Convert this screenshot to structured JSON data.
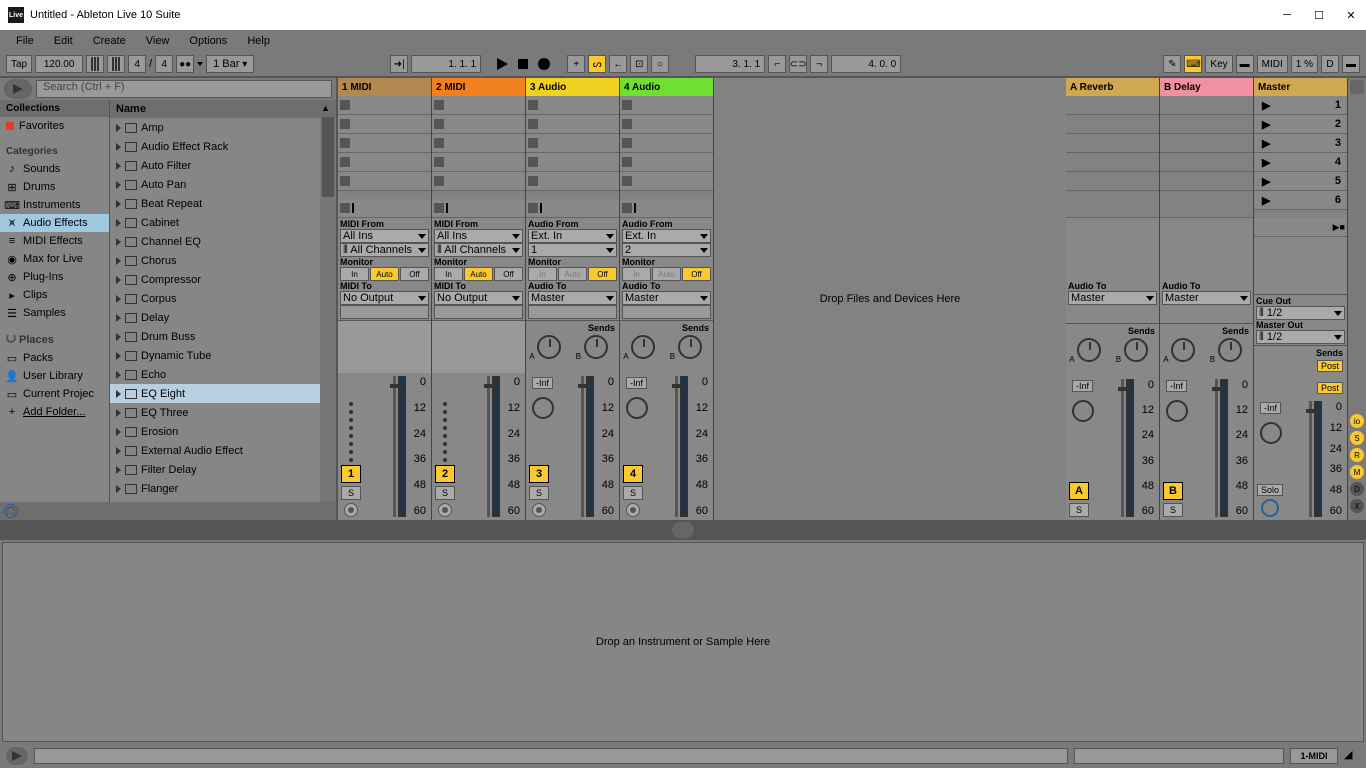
{
  "window": {
    "title": "Untitled - Ableton Live 10 Suite",
    "logo": "Live"
  },
  "menu": [
    "File",
    "Edit",
    "Create",
    "View",
    "Options",
    "Help"
  ],
  "ctrl": {
    "tap": "Tap",
    "bpm": "120.00",
    "sig_num": "4",
    "sig_den": "4",
    "bar": "1 Bar",
    "pos": "1.   1.   1",
    "loop_pos": "3.   1.   1",
    "loop_len": "4.   0.   0",
    "key": "Key",
    "midi": "MIDI",
    "cpu": "1 %",
    "d": "D"
  },
  "browser": {
    "search_ph": "Search (Ctrl + F)",
    "collections_hdr": "Collections",
    "favorites": "Favorites",
    "categories_hdr": "Categories",
    "cats": [
      "Sounds",
      "Drums",
      "Instruments",
      "Audio Effects",
      "MIDI Effects",
      "Max for Live",
      "Plug-Ins",
      "Clips",
      "Samples"
    ],
    "cat_selected": 3,
    "places_hdr": "Places",
    "places": [
      "Packs",
      "User Library",
      "Current Projec",
      "Add Folder..."
    ],
    "name_hdr": "Name",
    "items": [
      "Amp",
      "Audio Effect Rack",
      "Auto Filter",
      "Auto Pan",
      "Beat Repeat",
      "Cabinet",
      "Channel EQ",
      "Chorus",
      "Compressor",
      "Corpus",
      "Delay",
      "Drum Buss",
      "Dynamic Tube",
      "Echo",
      "EQ Eight",
      "EQ Three",
      "Erosion",
      "External Audio Effect",
      "Filter Delay",
      "Flanger"
    ],
    "item_selected": 14
  },
  "tracks": [
    {
      "name": "1 MIDI",
      "color": "c-brown",
      "from_lbl": "MIDI From",
      "from": "All Ins",
      "ch": "⦀ All Channels",
      "mon": "Auto",
      "to_lbl": "MIDI To",
      "to": "No Output",
      "num": "1",
      "inf": "",
      "has_sends": false,
      "dots": true,
      "rec": true
    },
    {
      "name": "2 MIDI",
      "color": "c-orange",
      "from_lbl": "MIDI From",
      "from": "All Ins",
      "ch": "⦀ All Channels",
      "mon": "Auto",
      "to_lbl": "MIDI To",
      "to": "No Output",
      "num": "2",
      "inf": "",
      "has_sends": false,
      "dots": true,
      "rec": true
    },
    {
      "name": "3 Audio",
      "color": "c-yellow",
      "from_lbl": "Audio From",
      "from": "Ext. In",
      "ch": "1",
      "mon": "Off",
      "to_lbl": "Audio To",
      "to": "Master",
      "num": "3",
      "inf": "-Inf",
      "has_sends": true,
      "rec": true
    },
    {
      "name": "4 Audio",
      "color": "c-green",
      "from_lbl": "Audio From",
      "from": "Ext. In",
      "ch": "2",
      "mon": "Off",
      "to_lbl": "Audio To",
      "to": "Master",
      "num": "4",
      "inf": "-Inf",
      "has_sends": true,
      "rec": true
    }
  ],
  "returns": [
    {
      "name": "A Reverb",
      "color": "c-tan",
      "to_lbl": "Audio To",
      "to": "Master",
      "num": "A",
      "inf": "-Inf"
    },
    {
      "name": "B Delay",
      "color": "c-pink",
      "to_lbl": "Audio To",
      "to": "Master",
      "num": "B",
      "inf": "-Inf"
    }
  ],
  "master": {
    "name": "Master",
    "scenes": [
      "1",
      "2",
      "3",
      "4",
      "5",
      "6"
    ],
    "cue_lbl": "Cue Out",
    "cue": "⦀ 1/2",
    "out_lbl": "Master Out",
    "out": "⦀ 1/2",
    "post": "Post",
    "solo": "Solo",
    "inf": "-Inf"
  },
  "io_labels": {
    "monitor": "Monitor",
    "in": "In",
    "auto": "Auto",
    "off": "Off",
    "sends": "Sends",
    "s": "S"
  },
  "db_ticks": [
    "0",
    "12",
    "24",
    "36",
    "48",
    "60"
  ],
  "drop_files": "Drop Files and Devices Here",
  "drop_device": "Drop an Instrument or Sample Here",
  "status_track": "1-MIDI"
}
